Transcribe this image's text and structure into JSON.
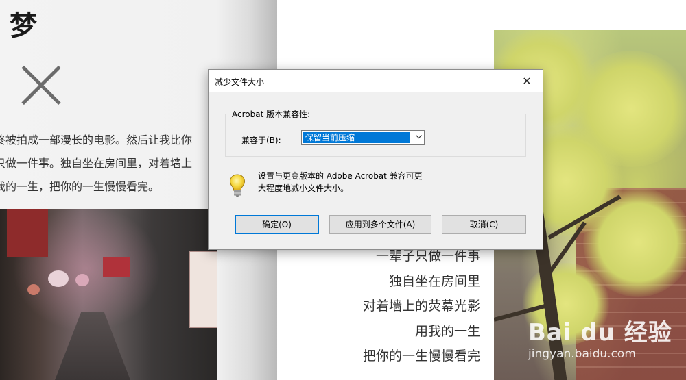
{
  "background": {
    "left_page": {
      "title": "梦",
      "text_lines": [
        "终被拍成一部漫长的电影。然后让我比你",
        "只做一件事。独自坐在房间里，对着墙上",
        "我的一生，把你的一生慢慢看完。"
      ]
    },
    "right_page": {
      "poem_lines": [
        "一辈子只做一件事",
        "独自坐在房间里",
        "对着墙上的荧幕光影",
        "用我的一生",
        "把你的一生慢慢看完"
      ]
    },
    "watermark": {
      "logo": "Bai du 经验",
      "url": "jingyan.baidu.com"
    }
  },
  "dialog": {
    "title": "减少文件大小",
    "close_symbol": "✕",
    "group_label": "Acrobat 版本兼容性:",
    "compat_label": "兼容于(B):",
    "compat_value": "保留当前压缩",
    "info_text_line1": "设置与更高版本的 Adobe Acrobat 兼容可更",
    "info_text_line2": "大程度地减小文件大小。",
    "buttons": {
      "ok": "确定(O)",
      "apply_multiple": "应用到多个文件(A)",
      "cancel": "取消(C)"
    },
    "accent_color": "#0078d7",
    "icons": [
      "close-icon",
      "chevron-down-icon",
      "lightbulb-icon"
    ]
  }
}
